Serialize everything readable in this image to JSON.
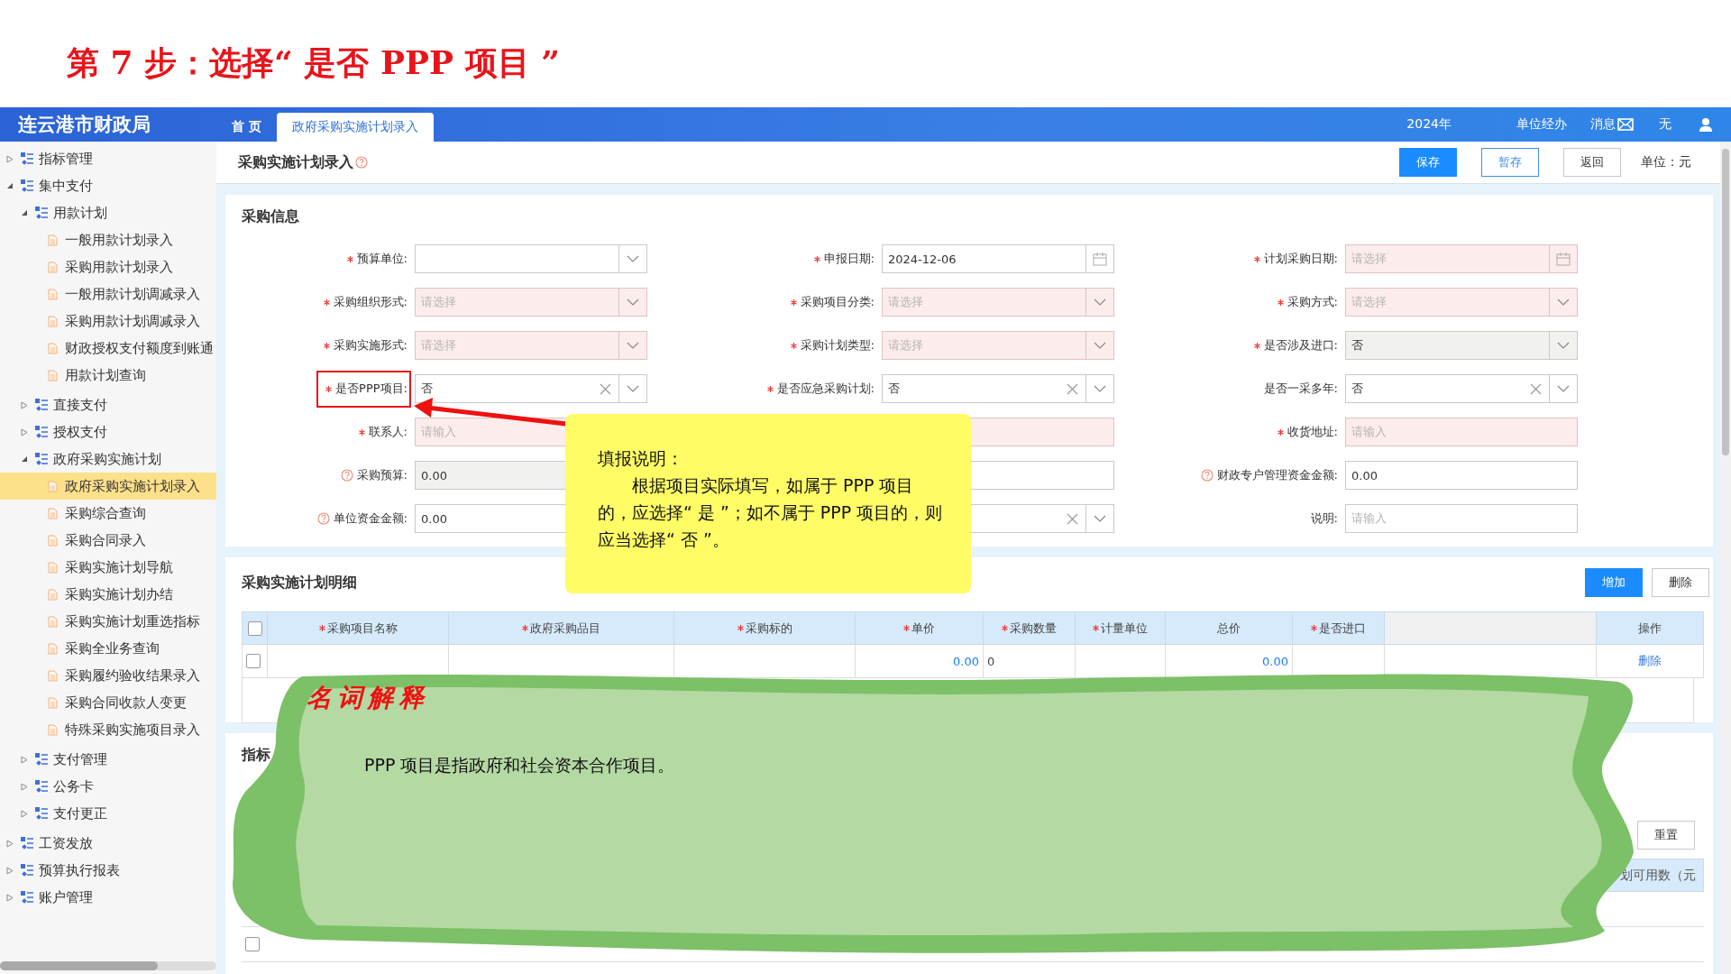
{
  "step_title": "第 7 步：选择“ 是否 PPP 项目 ”",
  "header": {
    "logo": "连云港市财政局",
    "tabs": [
      {
        "label": "首 页",
        "selected": false
      },
      {
        "label": "政府采购实施计划录入",
        "selected": true
      }
    ],
    "year": "2024年",
    "role": "单位经办",
    "messages": "消息",
    "user": "无"
  },
  "sidebar": {
    "items": [
      {
        "label": "指标管理",
        "expanded": false
      },
      {
        "label": "集中支付",
        "expanded": true,
        "children": [
          {
            "label": "用款计划",
            "expanded": true,
            "children": [
              {
                "label": "一般用款计划录入",
                "selected": false
              },
              {
                "label": "采购用款计划录入",
                "selected": false
              },
              {
                "label": "一般用款计划调减录入",
                "selected": false
              },
              {
                "label": "采购用款计划调减录入",
                "selected": false
              },
              {
                "label": "财政授权支付额度到账通",
                "selected": false
              },
              {
                "label": "用款计划查询",
                "selected": false
              }
            ]
          },
          {
            "label": "直接支付",
            "expanded": false
          },
          {
            "label": "授权支付",
            "expanded": false
          },
          {
            "label": "政府采购实施计划",
            "expanded": true,
            "children": [
              {
                "label": "政府采购实施计划录入",
                "selected": true
              },
              {
                "label": "采购综合查询",
                "selected": false
              },
              {
                "label": "采购合同录入",
                "selected": false
              },
              {
                "label": "采购实施计划导航",
                "selected": false
              },
              {
                "label": "采购实施计划办结",
                "selected": false
              },
              {
                "label": "采购实施计划重选指标",
                "selected": false
              },
              {
                "label": "采购全业务查询",
                "selected": false
              },
              {
                "label": "采购履约验收结果录入",
                "selected": false
              },
              {
                "label": "采购合同收款人变更",
                "selected": false
              },
              {
                "label": "特殊采购实施项目录入",
                "selected": false
              }
            ]
          },
          {
            "label": "支付管理",
            "expanded": false
          },
          {
            "label": "公务卡",
            "expanded": false
          },
          {
            "label": "支付更正",
            "expanded": false
          }
        ]
      },
      {
        "label": "工资发放",
        "expanded": false
      },
      {
        "label": "预算执行报表",
        "expanded": false
      },
      {
        "label": "账户管理",
        "expanded": false
      }
    ]
  },
  "page": {
    "title": "采购实施计划录入",
    "buttons": [
      {
        "label": "保存",
        "kind": "primary"
      },
      {
        "label": "暂存",
        "kind": "outline"
      },
      {
        "label": "返回",
        "kind": "default"
      }
    ],
    "unit": "单位：元"
  },
  "form": {
    "title": "采购信息",
    "fields": [
      {
        "label": "预算单位:",
        "required": true,
        "kind": "select",
        "invalid": false,
        "disabled": false
      },
      {
        "label": "申报日期:",
        "required": true,
        "kind": "date",
        "value": "2024-12-06",
        "invalid": false,
        "disabled": false
      },
      {
        "label": "计划采购日期:",
        "required": true,
        "kind": "date",
        "placeholder": "请选择",
        "invalid": true,
        "disabled": false
      },
      {
        "label": "采购组织形式:",
        "required": true,
        "kind": "select",
        "placeholder": "请选择",
        "invalid": true,
        "disabled": false
      },
      {
        "label": "采购项目分类:",
        "required": true,
        "kind": "select",
        "placeholder": "请选择",
        "invalid": true,
        "disabled": false
      },
      {
        "label": "采购方式:",
        "required": true,
        "kind": "select",
        "placeholder": "请选择",
        "invalid": true,
        "disabled": false
      },
      {
        "label": "采购实施形式:",
        "required": true,
        "kind": "select",
        "placeholder": "请选择",
        "invalid": true,
        "disabled": false
      },
      {
        "label": "采购计划类型:",
        "required": true,
        "kind": "select",
        "placeholder": "请选择",
        "invalid": true,
        "disabled": false
      },
      {
        "label": "是否涉及进口:",
        "required": true,
        "kind": "select",
        "value": "否",
        "invalid": false,
        "disabled": true
      },
      {
        "label": "是否PPP项目:",
        "required": true,
        "kind": "select",
        "value": "否",
        "clearable": true,
        "highlighted": true,
        "invalid": false,
        "disabled": false
      },
      {
        "label": "是否应急采购计划:",
        "required": true,
        "kind": "select",
        "value": "否",
        "clearable": true,
        "invalid": false,
        "disabled": false
      },
      {
        "label": "是否一采多年:",
        "required": false,
        "kind": "select",
        "value": "否",
        "clearable": true,
        "invalid": false,
        "disabled": false
      },
      {
        "label": "联系人:",
        "required": true,
        "kind": "text",
        "placeholder": "请输入",
        "invalid": true,
        "disabled": false
      },
      {
        "kind": "text",
        "invalid": true,
        "disabled": false
      },
      {
        "label": "收货地址:",
        "required": true,
        "kind": "text",
        "placeholder": "请输入",
        "invalid": true,
        "disabled": false
      },
      {
        "label": "采购预算:",
        "help": true,
        "kind": "text",
        "value": "0.00",
        "invalid": false,
        "disabled": true
      },
      {
        "kind": "text",
        "invalid": false,
        "disabled": false
      },
      {
        "label": "财政专户管理资金金额:",
        "help": true,
        "kind": "text",
        "value": "0.00",
        "invalid": false,
        "disabled": false
      },
      {
        "label": "单位资金金额:",
        "help": true,
        "kind": "text",
        "value": "0.00",
        "invalid": false,
        "disabled": false
      },
      {
        "kind": "select",
        "clearable": true,
        "invalid": false,
        "disabled": false
      },
      {
        "label": "说明:",
        "kind": "text",
        "placeholder": "请输入",
        "invalid": false,
        "disabled": false
      }
    ]
  },
  "detail": {
    "title": "采购实施计划明细",
    "buttons": [
      {
        "label": "增加",
        "kind": "primary"
      },
      {
        "label": "删除",
        "kind": "default"
      }
    ],
    "columns": [
      {
        "label": "采购项目名称",
        "required": true
      },
      {
        "label": "政府采购品目",
        "required": true
      },
      {
        "label": "采购标的",
        "required": true
      },
      {
        "label": "单价",
        "required": true
      },
      {
        "label": "采购数量",
        "required": true
      },
      {
        "label": "计量单位",
        "required": true
      },
      {
        "label": "总价",
        "required": false
      },
      {
        "label": "是否进口",
        "required": true
      },
      {
        "label": "操作",
        "required": false
      }
    ],
    "header_checked": false,
    "rows": [
      {
        "checked": false,
        "unit_price": "0.00",
        "quantity": "0",
        "total": "0.00",
        "action": "删除"
      }
    ]
  },
  "index_section": {
    "title": "指标",
    "reset_button": "重置",
    "last_column": "划可用数（元",
    "rows": [
      {
        "checked": false
      }
    ]
  },
  "tip": {
    "title": "填报说明：",
    "text": "根据项目实际填写，如属于 PPP 项目的，应选择“ 是 ”；如不属于 PPP 项目的，则应当选择“ 否 ”。"
  },
  "glossary": {
    "title": "名词解释",
    "text": "PPP 项目是指政府和社会资本合作项目。"
  }
}
